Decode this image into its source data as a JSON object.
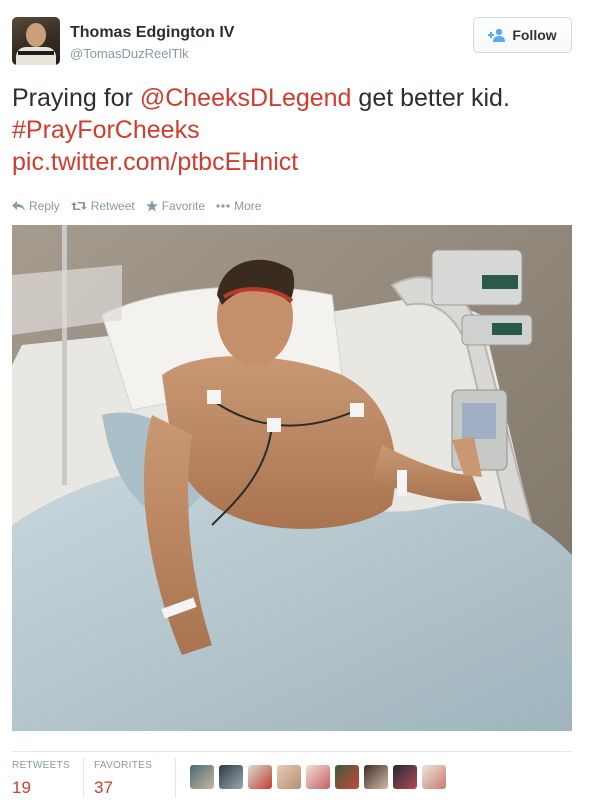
{
  "user": {
    "name": "Thomas Edgington IV",
    "handle": "@TomasDuzReelTlk"
  },
  "follow_button": {
    "label": "Follow",
    "icon": "add-user-icon"
  },
  "tweet": {
    "text_parts": {
      "prefix": "Praying for ",
      "mention": "@CheeksDLegend",
      "middle": " get better kid. ",
      "hashtag": "#PrayForCheeks",
      "link": "pic.twitter.com/ptbcEHnict"
    },
    "link_color": "#d23b2e"
  },
  "actions": [
    {
      "label": "Reply",
      "icon": "reply-icon"
    },
    {
      "label": "Retweet",
      "icon": "retweet-icon"
    },
    {
      "label": "Favorite",
      "icon": "star-icon"
    },
    {
      "label": "More",
      "icon": "more-dots-icon"
    }
  ],
  "photo": {
    "subject": "photo"
  },
  "stats": {
    "retweets": {
      "label": "RETWEETS",
      "value": "19"
    },
    "favorites": {
      "label": "FAVORITES",
      "value": "37"
    }
  },
  "favoriters_count": 9
}
